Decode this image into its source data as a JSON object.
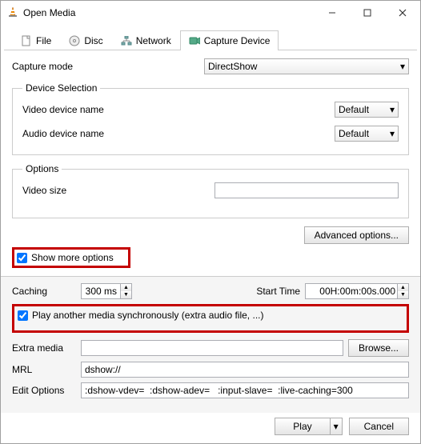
{
  "window": {
    "title": "Open Media"
  },
  "tabs": {
    "file": "File",
    "disc": "Disc",
    "network": "Network",
    "capture": "Capture Device"
  },
  "capture": {
    "mode_label": "Capture mode",
    "mode_value": "DirectShow",
    "device_selection": {
      "legend": "Device Selection",
      "video_label": "Video device name",
      "video_value": "Default",
      "audio_label": "Audio device name",
      "audio_value": "Default"
    },
    "options": {
      "legend": "Options",
      "video_size_label": "Video size",
      "video_size_value": ""
    },
    "advanced_btn": "Advanced options..."
  },
  "more": {
    "show_more_label": "Show more options",
    "caching_label": "Caching",
    "caching_value": "300 ms",
    "start_time_label": "Start Time",
    "start_time_value": "00H:00m:00s.000",
    "play_sync_label": "Play another media synchronously (extra audio file, ...)",
    "extra_media_label": "Extra media",
    "extra_media_value": "",
    "browse_btn": "Browse...",
    "mrl_label": "MRL",
    "mrl_value": "dshow://",
    "edit_options_label": "Edit Options",
    "edit_options_value": ":dshow-vdev=  :dshow-adev=   :input-slave=  :live-caching=300"
  },
  "buttons": {
    "play": "Play",
    "cancel": "Cancel"
  }
}
